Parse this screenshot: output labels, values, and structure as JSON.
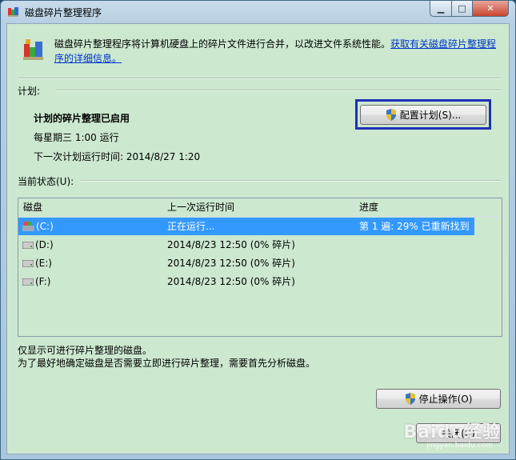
{
  "window": {
    "title": "磁盘碎片整理程序"
  },
  "description": {
    "text": "磁盘碎片整理程序将计算机硬盘上的碎片文件进行合并，以改进文件系统性能。",
    "link": "获取有关磁盘碎片整理程序的详细信息。"
  },
  "schedule": {
    "section_label": "计划:",
    "status": "计划的碎片整理已启用",
    "frequency": "每星期三  1:00 运行",
    "next_run": "下一次计划运行时间: 2014/8/27 1:20",
    "configure_button": "配置计划(S)..."
  },
  "current_status": {
    "section_label": "当前状态(U):",
    "columns": [
      "磁盘",
      "上一次运行时间",
      "进度"
    ],
    "rows": [
      {
        "disk": "(C:)",
        "last_run": "正在运行...",
        "progress": "第 1 遍: 29% 已重新找到"
      },
      {
        "disk": "(D:)",
        "last_run": "2014/8/23 12:50 (0% 碎片)",
        "progress": ""
      },
      {
        "disk": "(E:)",
        "last_run": "2014/8/23 12:50 (0% 碎片)",
        "progress": ""
      },
      {
        "disk": "(F:)",
        "last_run": "2014/8/23 12:50 (0% 碎片)",
        "progress": ""
      }
    ]
  },
  "notes": {
    "line1": "仅显示可进行碎片整理的磁盘。",
    "line2": "为了最好地确定磁盘是否需要立即进行碎片整理，需要首先分析磁盘。"
  },
  "buttons": {
    "stop": "停止操作(O)",
    "close": "关闭(C)"
  },
  "watermark": {
    "text": "Baidu经验",
    "sub": "jingyan.baidu.com"
  },
  "colors": {
    "client_bg": "#cce8cf",
    "selection": "#3399ff",
    "link": "#0033cc"
  },
  "icons": {
    "app": "defrag-icon",
    "shield": "uac-shield-icon",
    "drive": "drive-icon"
  }
}
